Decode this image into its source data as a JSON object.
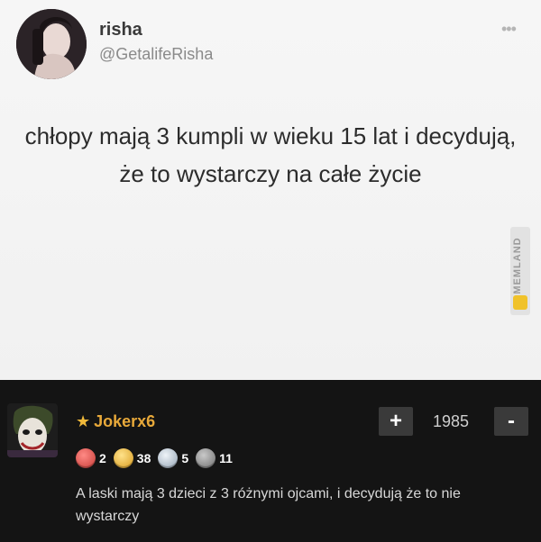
{
  "tweet": {
    "display_name": "risha",
    "handle": "@GetalifeRisha",
    "more_icon": "more-dots-icon",
    "text": "chłopy mają 3 kumpli w wieku 15 lat i decydują, że to wystarczy na całe życie"
  },
  "watermark": {
    "text": "MEMLAND"
  },
  "comment": {
    "username": "Jokerx6",
    "star_icon": "star-icon",
    "vote_plus": "+",
    "vote_minus": "-",
    "score": "1985",
    "badges": [
      {
        "icon": "red-badge-icon",
        "color": "#d9534f",
        "value": "2"
      },
      {
        "icon": "gold-badge-icon",
        "color": "#e8b53a",
        "value": "38"
      },
      {
        "icon": "silver-badge-icon",
        "color": "#b9c4cf",
        "value": "5"
      },
      {
        "icon": "gray-badge-icon",
        "color": "#8a8a8a",
        "value": "11"
      }
    ],
    "text": "A laski mają 3 dzieci z 3 różnymi ojcami, i decydują że to nie wystarczy"
  }
}
